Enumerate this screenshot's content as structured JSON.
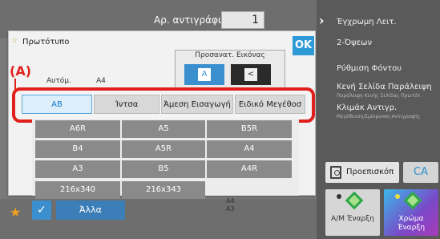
{
  "header": {
    "copies_label": "Αρ. αντιγράφων",
    "copies_value": "1"
  },
  "right_panel": {
    "items": [
      {
        "label": "Έγχρωμη Λειτ.",
        "sub": ""
      },
      {
        "label": "2-Όψεων",
        "sub": ""
      },
      {
        "label": "Ρύθμιση Φόντου",
        "sub": ""
      },
      {
        "label": "Κενή Σελίδα Παράλειψη",
        "sub": "Παράλειψη Κενής Σελίδας Πρωτότ."
      },
      {
        "label": "Κλιμάκ Αντιγρ.",
        "sub": "Μεγέθυνση/Σμίκρυνση Αντιγραφής"
      }
    ],
    "preview_label": "Προεπισκόπ",
    "ca_label": "CA",
    "bw_start": "Α/Μ Έναρξη",
    "color_start": "Χρώμα Έναρξη"
  },
  "bottom": {
    "other_label": "Άλλα",
    "frag1": "A4",
    "frag2": "A3"
  },
  "dialog": {
    "title": "Πρωτότυπο",
    "ok_label": "OK",
    "image_adjust_label": "Προσανατ. Εικόνας",
    "auto_label": "Αυτόμ.",
    "size_label": "A4"
  },
  "annotation": {
    "label": "(A)",
    "color": "#e0201c"
  },
  "tabs": [
    "AB",
    "Ίντσα",
    "Άμεση Εισαγωγή",
    "Ειδικό Μεγέθοσ"
  ],
  "sizes": [
    "A6R",
    "A5",
    "B5R",
    "B4",
    "A5R",
    "A4",
    "A3",
    "B5",
    "A4R",
    "216x340",
    "216x343"
  ]
}
